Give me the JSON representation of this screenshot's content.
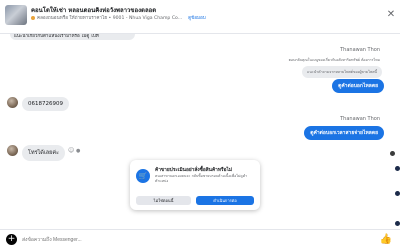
{
  "header": {
    "title": "คอนโดให้เช่า หลอนดอนคิงห่อวังพลาวของตลอด",
    "location": "คลองถนอนหรือ ให้ถ่ายทาบราคาไฮ • 9001 - Nhua Viga Champ Co...",
    "view_link": "ดูข้อมอบ"
  },
  "pinned_text": "แนะนำเกี่ยวกับตำแหน่งเรามาหรือ ไม่ดู ไปที่",
  "messages": {
    "sender1": "Thanawan Thon",
    "reply_note1": "ตอบกลับคุณในเมนูของเกี่ยวกับอสังหาริมทรัพย์ ต้องการไหม",
    "quoted1": "แนะนำคำถามจากหลายโพสต์ของผู้ขายโพสนี้",
    "me1": "ดูคำต่อบอกไหลตย",
    "them1": "0618726909",
    "sender2": "Thanawan Thon",
    "me2": "ดูคำต่อบอกเวลาสายจ่ายไหลดย",
    "them2": "โทรได้เลยค่ะ",
    "emoji": "☺"
  },
  "popup": {
    "title": "ค้าขายประเมินอย่าสั่งซื้อสินค้าหรือไม่",
    "body": "คนเสาขาบอกเองคนจะ กลับซื้อขายบรอบค้าอเนื้อเพื่อไม่ดูคำตำแหน่ง",
    "decline": "ไม่ใช่ตอนนี้",
    "accept": "ดำเนินการต่อ"
  },
  "composer": {
    "placeholder": "ส่งข้อความถึง Messenger..."
  },
  "colors": {
    "accent": "#1b74e4",
    "bubble_gray": "#e9ebee"
  }
}
